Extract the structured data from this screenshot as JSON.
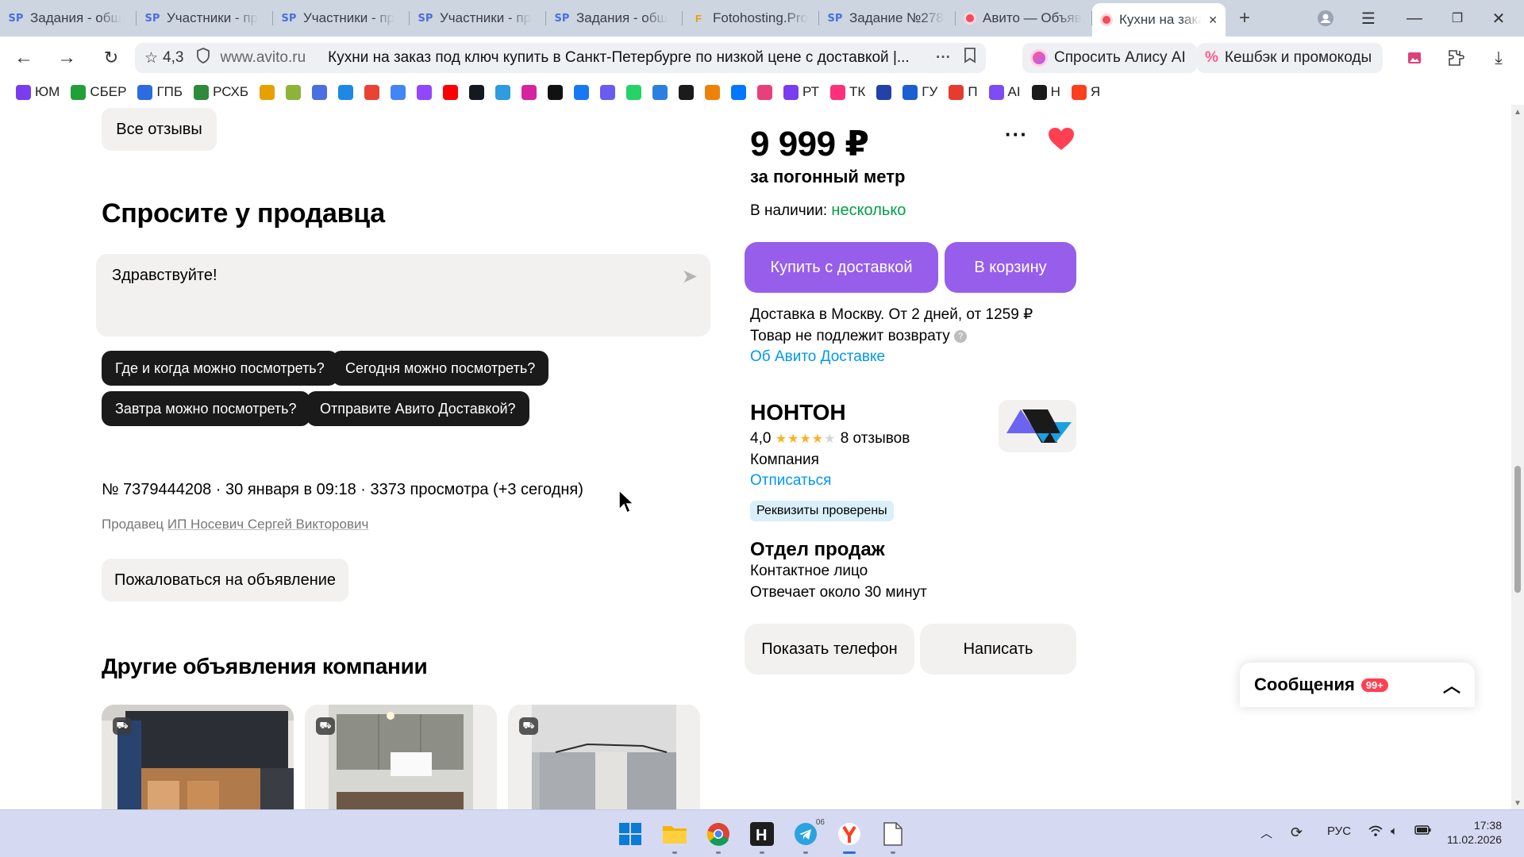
{
  "browser": {
    "tabs": [
      {
        "favicon": "sp-icon",
        "title": "Задания - общ"
      },
      {
        "favicon": "sp-icon",
        "title": "Участники - пр"
      },
      {
        "favicon": "sp-icon",
        "title": "Участники - пр"
      },
      {
        "favicon": "sp-icon",
        "title": "Участники - пр"
      },
      {
        "favicon": "sp-icon",
        "title": "Задания - общ"
      },
      {
        "favicon": "fotohosting-icon",
        "title": "Fotohosting.Pro"
      },
      {
        "favicon": "sp-icon",
        "title": "Задание №278"
      },
      {
        "favicon": "avito-icon",
        "title": "Авито — Объяв"
      },
      {
        "favicon": "avito-icon",
        "title": "Кухни на зака",
        "active": true
      }
    ],
    "site_rating": "4,3",
    "domain": "www.avito.ru",
    "page_title": "Кухни на заказ под ключ купить в Санкт-Петербурге по низкой цене с доставкой |...",
    "alice_button": "Спросить Алису AI",
    "cashback_button": "Кешбэк и промокоды",
    "bookmarks": [
      {
        "icon": "yum-icon",
        "label": "ЮМ",
        "color": "#7a3cf0"
      },
      {
        "icon": "sber-icon",
        "label": "СБЕР",
        "color": "#21a038"
      },
      {
        "icon": "gpb-icon",
        "label": "ГПБ",
        "color": "#2d6ce0"
      },
      {
        "icon": "rshb-icon",
        "label": "РСХБ",
        "color": "#2f8a3b"
      },
      {
        "icon": "f-icon",
        "label": "",
        "color": "#e6a100"
      },
      {
        "icon": "sf-icon",
        "label": "",
        "color": "#8db33a"
      },
      {
        "icon": "sp-icon",
        "label": "",
        "color": "#4a6fe0"
      },
      {
        "icon": "mail-icon",
        "label": "",
        "color": "#1e88e5"
      },
      {
        "icon": "gmail-icon",
        "label": "",
        "color": "#ea4335"
      },
      {
        "icon": "google-icon",
        "label": "",
        "color": "#4285f4"
      },
      {
        "icon": "twitch-icon",
        "label": "",
        "color": "#9146ff"
      },
      {
        "icon": "youtube-icon",
        "label": "",
        "color": "#ff0000"
      },
      {
        "icon": "rutube-icon",
        "label": "",
        "color": "#14191f"
      },
      {
        "icon": "cloud-icon",
        "label": "",
        "color": "#2f9be0"
      },
      {
        "icon": "instagram-icon",
        "label": "",
        "color": "#d6249f"
      },
      {
        "icon": "tiktok-icon",
        "label": "",
        "color": "#111111"
      },
      {
        "icon": "facebook-icon",
        "label": "",
        "color": "#1877f2"
      },
      {
        "icon": "camera-icon",
        "label": "",
        "color": "#6a5cf0"
      },
      {
        "icon": "whatsapp-icon",
        "label": "",
        "color": "#25d366"
      },
      {
        "icon": "t-icon",
        "label": "",
        "color": "#2b7fe0"
      },
      {
        "icon": "plus-icon",
        "label": "",
        "color": "#1b1b1b"
      },
      {
        "icon": "ok-icon",
        "label": "",
        "color": "#ee8208"
      },
      {
        "icon": "vk-icon",
        "label": "",
        "color": "#0077ff"
      },
      {
        "icon": "colors-icon",
        "label": "",
        "color": "#e8407a"
      },
      {
        "icon": "rt-icon",
        "label": "РТ",
        "color": "#7a3cf0"
      },
      {
        "icon": "tk-icon",
        "label": "ТК",
        "color": "#ff2f7a"
      },
      {
        "icon": "emblem-icon",
        "label": "",
        "color": "#2441a8"
      },
      {
        "icon": "gu-icon",
        "label": "ГУ",
        "color": "#1c5fd0"
      },
      {
        "icon": "p-icon",
        "label": "П",
        "color": "#e63b2e"
      },
      {
        "icon": "ai-icon",
        "label": "AI",
        "color": "#7d4cf5"
      },
      {
        "icon": "h-icon",
        "label": "Н",
        "color": "#1b1b1b"
      },
      {
        "icon": "ya-icon",
        "label": "Я",
        "color": "#fc3f1d"
      }
    ]
  },
  "page": {
    "all_reviews_button": "Все отзывы",
    "ask_seller_title": "Спросите у продавца",
    "message_text": "Здравствуйте!",
    "quick_questions": [
      "Где и когда можно посмотреть?",
      "Сегодня можно посмотреть?",
      "Завтра можно посмотреть?",
      "Отправите Авито Доставкой?"
    ],
    "listing_meta": "№ 7379444208 · 30 января в 09:18 · 3373 просмотра (+3 сегодня)",
    "seller_prefix": "Продавец ",
    "seller_name": "ИП Носевич Сергей Викторович",
    "report_button": "Пожаловаться на объявление",
    "other_listings_title": "Другие объявления компании",
    "price": "9 999 ₽",
    "price_unit": "за погонный метр",
    "availability_label": "В наличии: ",
    "availability_value": "несколько",
    "buy_delivery_button": "Купить с доставкой",
    "to_cart_button": "В корзину",
    "delivery_info": "Доставка в Москву. От 2 дней, от 1259 ₽",
    "no_return": "Товар не подлежит возврату",
    "about_delivery_link": "Об Авито Доставке",
    "company_name": "НОНТОН",
    "company_rating": "4,0",
    "company_rating_stars": 4,
    "company_reviews": "8 отзывов",
    "company_type": "Компания",
    "unsubscribe_link": "Отписаться",
    "verified_badge": "Реквизиты проверены",
    "department_title": "Отдел продаж",
    "contact_person": "Контактное лицо",
    "response_time": "Отвечает около 30 минут",
    "show_phone_button": "Показать телефон",
    "write_button": "Написать",
    "messages_label": "Сообщения",
    "messages_count": "99+"
  },
  "taskbar": {
    "apps": [
      "windows-start-icon",
      "file-explorer-icon",
      "chrome-icon",
      "hitpaw-icon",
      "telegram-icon",
      "yandex-browser-icon",
      "notepad-icon"
    ],
    "telegram_badge": "06",
    "language": "РУС",
    "time": "17:38",
    "date": "11.02.2026"
  },
  "colors": {
    "accent": "#965eeb",
    "link": "#0097f0",
    "green": "#00a046",
    "heart": "#ff4053"
  }
}
